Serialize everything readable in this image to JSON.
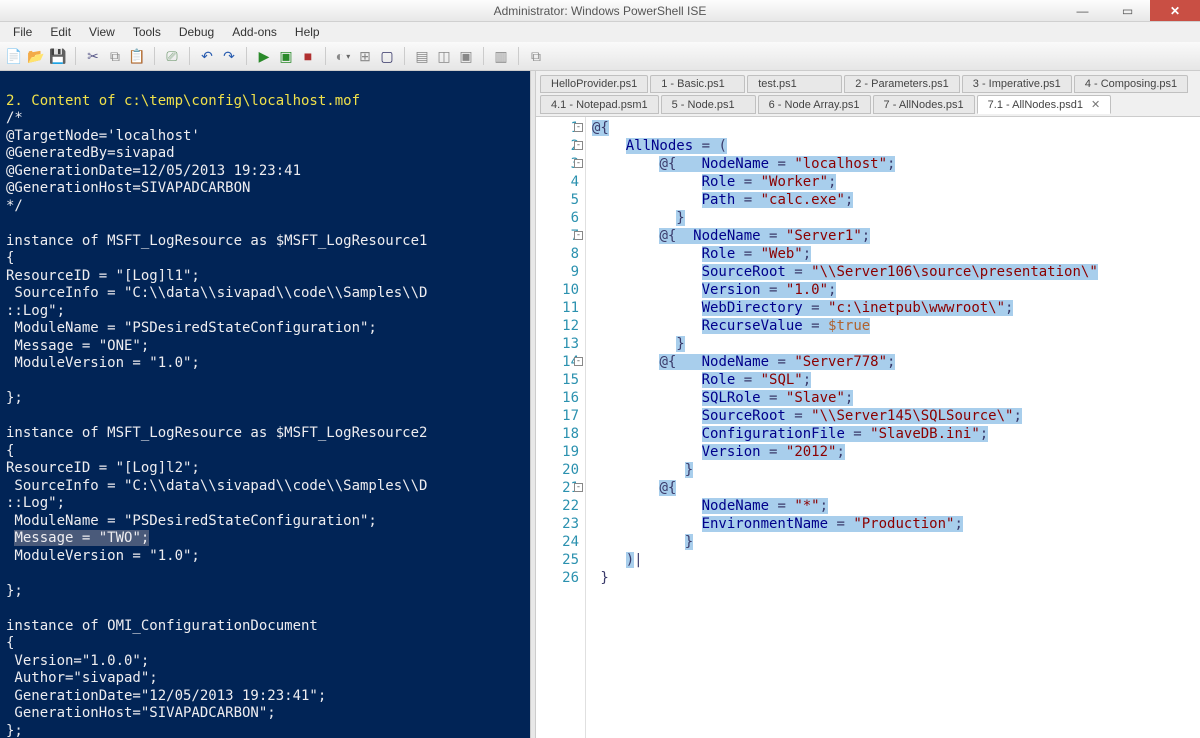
{
  "window": {
    "title": "Administrator: Windows PowerShell ISE"
  },
  "menubar": [
    "File",
    "Edit",
    "View",
    "Tools",
    "Debug",
    "Add-ons",
    "Help"
  ],
  "tabs": {
    "row1": [
      {
        "label": "HelloProvider.ps1"
      },
      {
        "label": "1 - Basic.ps1"
      },
      {
        "label": "test.ps1"
      },
      {
        "label": "2 - Parameters.ps1"
      },
      {
        "label": "3 - Imperative.ps1"
      },
      {
        "label": "4 - Composing.ps1"
      }
    ],
    "row2": [
      {
        "label": "4.1 - Notepad.psm1"
      },
      {
        "label": "5 - Node.ps1"
      },
      {
        "label": "6 - Node Array.ps1"
      },
      {
        "label": "7 - AllNodes.ps1"
      },
      {
        "label": "7.1 - AllNodes.psd1",
        "active": true
      }
    ]
  },
  "console": {
    "header": "2. Content of c:\\temp\\config\\localhost.mof",
    "lines": [
      "/*",
      "@TargetNode='localhost'",
      "@GeneratedBy=sivapad",
      "@GenerationDate=12/05/2013 19:23:41",
      "@GenerationHost=SIVAPADCARBON",
      "*/",
      "",
      "instance of MSFT_LogResource as $MSFT_LogResource1",
      "{",
      "ResourceID = \"[Log]l1\";",
      " SourceInfo = \"C:\\\\data\\\\sivapad\\\\code\\\\Samples\\\\D",
      "::Log\";",
      " ModuleName = \"PSDesiredStateConfiguration\";",
      " Message = \"ONE\";",
      " ModuleVersion = \"1.0\";",
      "",
      "};",
      "",
      "instance of MSFT_LogResource as $MSFT_LogResource2",
      "{",
      "ResourceID = \"[Log]l2\";",
      " SourceInfo = \"C:\\\\data\\\\sivapad\\\\code\\\\Samples\\\\D",
      "::Log\";",
      " ModuleName = \"PSDesiredStateConfiguration\";",
      " Message = \"TWO\";",
      " ModuleVersion = \"1.0\";",
      "",
      "};",
      "",
      "instance of OMI_ConfigurationDocument",
      "{",
      " Version=\"1.0.0\";",
      " Author=\"sivapad\";",
      " GenerationDate=\"12/05/2013 19:23:41\";",
      " GenerationHost=\"SIVAPADCARBON\";",
      "};"
    ]
  },
  "editor": {
    "line_count": 26,
    "tokens": [
      [
        {
          "c": "punct",
          "t": "@{",
          "sel": true
        }
      ],
      [
        {
          "t": "    "
        },
        {
          "c": "kw",
          "t": "AllNodes",
          "sel": true
        },
        {
          "c": "punct",
          "t": " = (",
          "sel": true
        }
      ],
      [
        {
          "t": "        "
        },
        {
          "c": "punct",
          "t": "@{   ",
          "sel": true
        },
        {
          "c": "kw",
          "t": "NodeName",
          "sel": true
        },
        {
          "c": "punct",
          "t": " = ",
          "sel": true
        },
        {
          "c": "str",
          "t": "\"localhost\"",
          "sel": true
        },
        {
          "c": "punct",
          "t": ";",
          "sel": true
        }
      ],
      [
        {
          "t": "             "
        },
        {
          "c": "kw",
          "t": "Role",
          "sel": true
        },
        {
          "c": "punct",
          "t": " = ",
          "sel": true
        },
        {
          "c": "str",
          "t": "\"Worker\"",
          "sel": true
        },
        {
          "c": "punct",
          "t": ";",
          "sel": true
        }
      ],
      [
        {
          "t": "             "
        },
        {
          "c": "kw",
          "t": "Path",
          "sel": true
        },
        {
          "c": "punct",
          "t": " = ",
          "sel": true
        },
        {
          "c": "str",
          "t": "\"calc.exe\"",
          "sel": true
        },
        {
          "c": "punct",
          "t": ";",
          "sel": true
        }
      ],
      [
        {
          "t": "          "
        },
        {
          "c": "punct",
          "t": "}",
          "sel": true
        }
      ],
      [
        {
          "t": "        "
        },
        {
          "c": "punct",
          "t": "@{  ",
          "sel": true
        },
        {
          "c": "kw",
          "t": "NodeName",
          "sel": true
        },
        {
          "c": "punct",
          "t": " = ",
          "sel": true
        },
        {
          "c": "str",
          "t": "\"Server1\"",
          "sel": true
        },
        {
          "c": "punct",
          "t": ";",
          "sel": true
        }
      ],
      [
        {
          "t": "             "
        },
        {
          "c": "kw",
          "t": "Role",
          "sel": true
        },
        {
          "c": "punct",
          "t": " = ",
          "sel": true
        },
        {
          "c": "str",
          "t": "\"Web\"",
          "sel": true
        },
        {
          "c": "punct",
          "t": ";",
          "sel": true
        }
      ],
      [
        {
          "t": "             "
        },
        {
          "c": "kw",
          "t": "SourceRoot",
          "sel": true
        },
        {
          "c": "punct",
          "t": " = ",
          "sel": true
        },
        {
          "c": "str",
          "t": "\"\\\\Server106\\source\\presentation\\\"",
          "sel": true
        }
      ],
      [
        {
          "t": "             "
        },
        {
          "c": "kw",
          "t": "Version",
          "sel": true
        },
        {
          "c": "punct",
          "t": " = ",
          "sel": true
        },
        {
          "c": "str",
          "t": "\"1.0\"",
          "sel": true
        },
        {
          "c": "punct",
          "t": ";",
          "sel": true
        }
      ],
      [
        {
          "t": "             "
        },
        {
          "c": "kw",
          "t": "WebDirectory",
          "sel": true
        },
        {
          "c": "punct",
          "t": " = ",
          "sel": true
        },
        {
          "c": "str",
          "t": "\"c:\\inetpub\\wwwroot\\\"",
          "sel": true
        },
        {
          "c": "punct",
          "t": ";",
          "sel": true
        }
      ],
      [
        {
          "t": "             "
        },
        {
          "c": "kw",
          "t": "RecurseValue",
          "sel": true
        },
        {
          "c": "punct",
          "t": " = ",
          "sel": true
        },
        {
          "c": "var",
          "t": "$true",
          "sel": true
        }
      ],
      [
        {
          "t": "          "
        },
        {
          "c": "punct",
          "t": "}",
          "sel": true
        }
      ],
      [
        {
          "t": "        "
        },
        {
          "c": "punct",
          "t": "@{   ",
          "sel": true
        },
        {
          "c": "kw",
          "t": "NodeName",
          "sel": true
        },
        {
          "c": "punct",
          "t": " = ",
          "sel": true
        },
        {
          "c": "str",
          "t": "\"Server778\"",
          "sel": true
        },
        {
          "c": "punct",
          "t": ";",
          "sel": true
        }
      ],
      [
        {
          "t": "             "
        },
        {
          "c": "kw",
          "t": "Role",
          "sel": true
        },
        {
          "c": "punct",
          "t": " = ",
          "sel": true
        },
        {
          "c": "str",
          "t": "\"SQL\"",
          "sel": true
        },
        {
          "c": "punct",
          "t": ";",
          "sel": true
        }
      ],
      [
        {
          "t": "             "
        },
        {
          "c": "kw",
          "t": "SQLRole",
          "sel": true
        },
        {
          "c": "punct",
          "t": " = ",
          "sel": true
        },
        {
          "c": "str",
          "t": "\"Slave\"",
          "sel": true
        },
        {
          "c": "punct",
          "t": ";",
          "sel": true
        }
      ],
      [
        {
          "t": "             "
        },
        {
          "c": "kw",
          "t": "SourceRoot",
          "sel": true
        },
        {
          "c": "punct",
          "t": " = ",
          "sel": true
        },
        {
          "c": "str",
          "t": "\"\\\\Server145\\SQLSource\\\"",
          "sel": true
        },
        {
          "c": "punct",
          "t": ";",
          "sel": true
        }
      ],
      [
        {
          "t": "             "
        },
        {
          "c": "kw",
          "t": "ConfigurationFile",
          "sel": true
        },
        {
          "c": "punct",
          "t": " = ",
          "sel": true
        },
        {
          "c": "str",
          "t": "\"SlaveDB.ini\"",
          "sel": true
        },
        {
          "c": "punct",
          "t": ";",
          "sel": true
        }
      ],
      [
        {
          "t": "             "
        },
        {
          "c": "kw",
          "t": "Version",
          "sel": true
        },
        {
          "c": "punct",
          "t": " = ",
          "sel": true
        },
        {
          "c": "str",
          "t": "\"2012\"",
          "sel": true
        },
        {
          "c": "punct",
          "t": ";",
          "sel": true
        }
      ],
      [
        {
          "t": "           "
        },
        {
          "c": "punct",
          "t": "}",
          "sel": true
        }
      ],
      [
        {
          "t": "        "
        },
        {
          "c": "punct",
          "t": "@{",
          "sel": true
        }
      ],
      [
        {
          "t": "             "
        },
        {
          "c": "kw",
          "t": "NodeName",
          "sel": true
        },
        {
          "c": "punct",
          "t": " = ",
          "sel": true
        },
        {
          "c": "str",
          "t": "\"*\"",
          "sel": true
        },
        {
          "c": "punct",
          "t": ";",
          "sel": true
        }
      ],
      [
        {
          "t": "             "
        },
        {
          "c": "kw",
          "t": "EnvironmentName",
          "sel": true
        },
        {
          "c": "punct",
          "t": " = ",
          "sel": true
        },
        {
          "c": "str",
          "t": "\"Production\"",
          "sel": true
        },
        {
          "c": "punct",
          "t": ";",
          "sel": true
        }
      ],
      [
        {
          "t": "           "
        },
        {
          "c": "punct",
          "t": "}",
          "sel": true
        }
      ],
      [
        {
          "t": "    "
        },
        {
          "c": "punct",
          "t": ")",
          "sel": true
        },
        {
          "c": "punct",
          "t": "|"
        }
      ],
      [
        {
          "c": "punct",
          "t": " }"
        }
      ]
    ]
  }
}
